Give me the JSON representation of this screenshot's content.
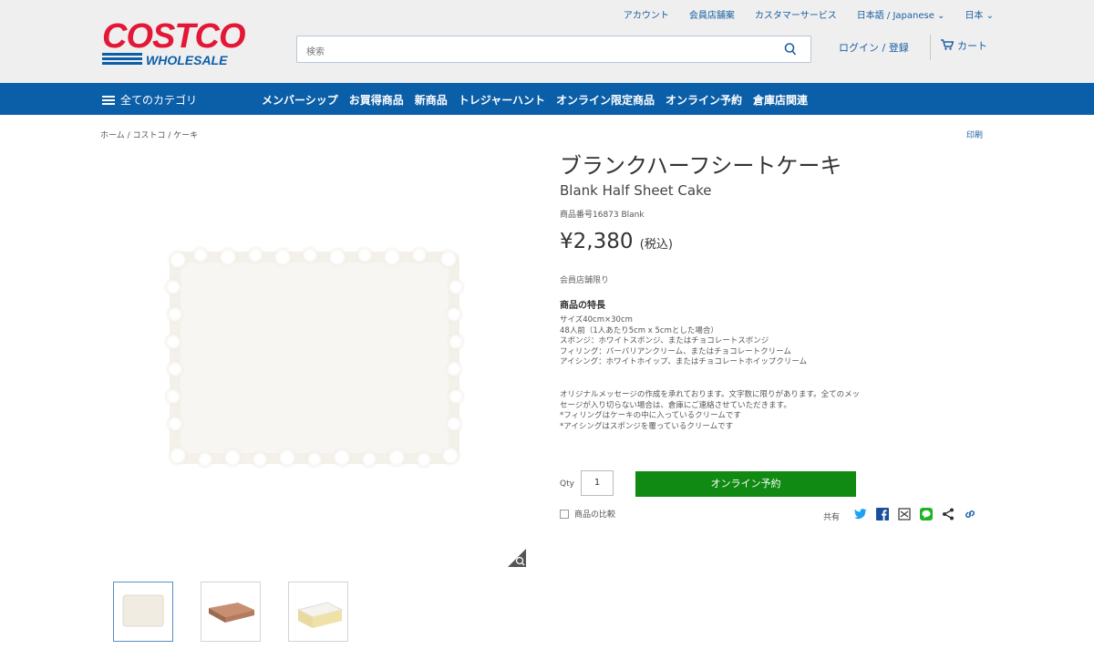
{
  "header": {
    "logo_text": "COSTCO WHOLESALE",
    "util_links": [
      "アカウント",
      "会員店舗案",
      "カスタマーサービス",
      "日本語 / Japanese ⌄",
      "日本 ⌄"
    ],
    "search_placeholder": "検索",
    "login_label": "ログイン / 登録",
    "cart_label": "カート"
  },
  "nav": {
    "all_categories": "全てのカテゴリ",
    "items": [
      "メンバーシップ",
      "お買得商品",
      "新商品",
      "トレジャーハント",
      "オンライン限定商品",
      "オンライン予約",
      "倉庫店関連"
    ]
  },
  "breadcrumb": "ホーム / コストコ / ケーキ",
  "print_label": "印刷",
  "product": {
    "title_ja": "ブランクハーフシートケーキ",
    "title_en": "Blank Half Sheet Cake",
    "item_number": "商品番号16873 Blank",
    "price": "¥2,380",
    "price_tax": "(税込)",
    "member_note": "会員店舗限り",
    "features_heading": "商品の特長",
    "features": [
      "サイズ40cm×30cm",
      "48人前（1人あたり5cm x 5cmとした場合）",
      "スポンジ：ホワイトスポンジ、またはチョコレートスポンジ",
      "フィリング：バーバリアンクリーム、またはチョコレートクリーム",
      "アイシング：ホワイトホイップ、またはチョコレートホイップクリーム"
    ],
    "notes": [
      "オリジナルメッセージの作成を承れております。文字数に限りがあります。全てのメッセージが入り切らない場合は、倉庫にご連絡させていただきます。",
      "*フィリングはケーキの中に入っているクリームです",
      "*アイシングはスポンジを覆っているクリームです"
    ],
    "qty_label": "Qty",
    "qty_value": "1",
    "add_button": "オンライン予約",
    "compare_label": "商品の比較",
    "share_label": "共有"
  },
  "colors": {
    "brand_red": "#e31837",
    "brand_blue": "#0b5ea8",
    "button_green": "#108a12"
  }
}
